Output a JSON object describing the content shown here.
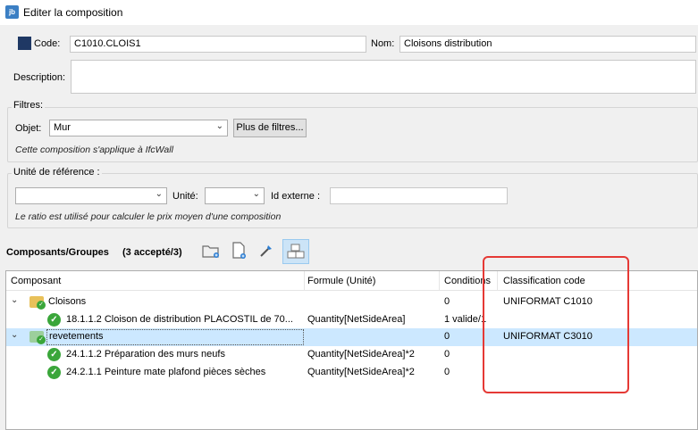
{
  "window": {
    "title": "Editer la composition",
    "app_icon_text": "jb"
  },
  "header": {
    "code_label": "Code:",
    "code_value": "C1010.CLOIS1",
    "nom_label": "Nom:",
    "nom_value": "Cloisons distribution",
    "description_label": "Description:",
    "description_value": "",
    "code_color": "#1f3864"
  },
  "filtres": {
    "group_label": "Filtres:",
    "objet_label": "Objet:",
    "objet_value": "Mur",
    "more_filters_button": "Plus de filtres...",
    "hint": "Cette composition s'applique à IfcWall"
  },
  "reference": {
    "group_label": "Unité de référence :",
    "unit_value": "",
    "unite_label": "Unité:",
    "unite_value": "",
    "id_externe_label": "Id externe :",
    "id_externe_value": "",
    "hint": "Le ratio est utilisé pour calculer le prix moyen d'une composition"
  },
  "composants": {
    "title": "Composants/Groupes",
    "count": "(3 accepté/3)",
    "toolbar": [
      "open-folder-icon",
      "new-file-icon",
      "eyedropper-icon",
      "cubes-icon"
    ]
  },
  "tree": {
    "columns": [
      "Composant",
      "Formule (Unité)",
      "Conditions",
      "Classification code"
    ],
    "rows": [
      {
        "name": "Cloisons",
        "formula": "",
        "conditions": "0",
        "classification": "UNIFORMAT C1010"
      },
      {
        "name": "18.1.1.2 Cloison de distribution PLACOSTIL de 70...",
        "formula": "Quantity[NetSideArea]",
        "conditions": "1 valide/1",
        "classification": ""
      },
      {
        "name": "revetements",
        "formula": "",
        "conditions": "0",
        "classification": "UNIFORMAT C3010"
      },
      {
        "name": "24.1.1.2 Préparation des murs neufs",
        "formula": "Quantity[NetSideArea]*2",
        "conditions": "0",
        "classification": ""
      },
      {
        "name": "24.2.1.1 Peinture mate plafond pièces sèches",
        "formula": "Quantity[NetSideArea]*2",
        "conditions": "0",
        "classification": ""
      }
    ]
  },
  "colors": {
    "selected_row": "#cce8ff",
    "highlight": "#e53935",
    "check": "#3aa63a"
  }
}
